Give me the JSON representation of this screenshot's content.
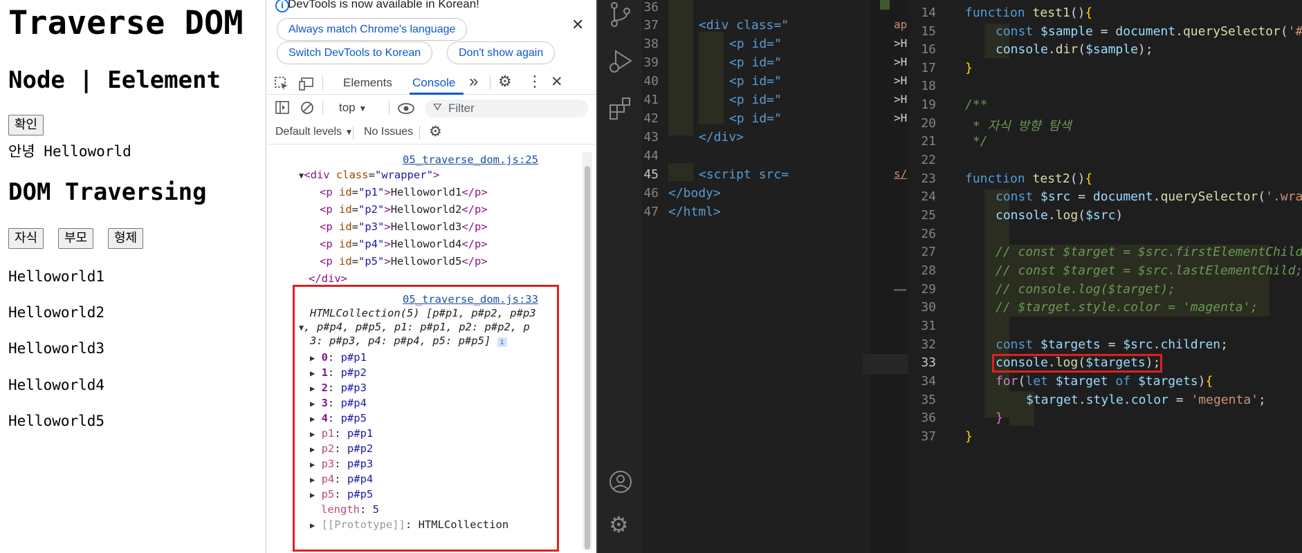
{
  "page": {
    "title": "Traverse DOM",
    "subtitle": "Node | Eelement",
    "confirm_button": "확인",
    "greeting_prefix": "안녕",
    "greeting_value": "Helloworld",
    "section_title": "DOM Traversing",
    "buttons": [
      "자식",
      "부모",
      "형제"
    ],
    "paragraphs": [
      "Helloworld1",
      "Helloworld2",
      "Helloworld3",
      "Helloworld4",
      "Helloworld5"
    ]
  },
  "devtools": {
    "infobar_text": "DevTools is now available in Korean!",
    "always_match": "Always match Chrome's language",
    "switch_korean": "Switch DevTools to Korean",
    "dont_show": "Don't show again",
    "tabs": [
      "Elements",
      "Console"
    ],
    "more_tabs": "»",
    "context": "top",
    "filter_placeholder": "Filter",
    "default_levels": "Default levels",
    "no_issues": "No Issues",
    "log1": {
      "source": "05_traverse_dom.js:25",
      "open_tag": "div",
      "class_attr": "class",
      "class_value": "\"wrapper\"",
      "paragraphs": [
        {
          "id": "\"p1\"",
          "text": "Helloworld1"
        },
        {
          "id": "\"p2\"",
          "text": "Helloworld2"
        },
        {
          "id": "\"p3\"",
          "text": "Helloworld3"
        },
        {
          "id": "\"p4\"",
          "text": "Helloworld4"
        },
        {
          "id": "\"p5\"",
          "text": "Helloworld5"
        }
      ],
      "close_tag": "</div>"
    },
    "log2": {
      "source": "05_traverse_dom.js:33",
      "summary_line1": "HTMLCollection(5) [p#p1, p#p2, p#p3",
      "summary_line2": ", p#p4, p#p5, p1: p#p1, p2: p#p2, p",
      "summary_line3": "3: p#p3, p4: p#p4, p5: p#p5]",
      "items": [
        {
          "key": "0",
          "value": "p#p1"
        },
        {
          "key": "1",
          "value": "p#p2"
        },
        {
          "key": "2",
          "value": "p#p3"
        },
        {
          "key": "3",
          "value": "p#p4"
        },
        {
          "key": "4",
          "value": "p#p5"
        },
        {
          "key": "p1",
          "value": "p#p1"
        },
        {
          "key": "p2",
          "value": "p#p2"
        },
        {
          "key": "p3",
          "value": "p#p3"
        },
        {
          "key": "p4",
          "value": "p#p4"
        },
        {
          "key": "p5",
          "value": "p#p5"
        }
      ],
      "length_key": "length",
      "length_value": "5",
      "prototype_key": "[[Prototype]]",
      "prototype_value": "HTMLCollection"
    }
  },
  "editor_left": {
    "lines": [
      {
        "n": "36",
        "html": ""
      },
      {
        "n": "37",
        "html": "<div class=\""
      },
      {
        "n": "38",
        "html": "<p id=\""
      },
      {
        "n": "39",
        "html": "<p id=\""
      },
      {
        "n": "40",
        "html": "<p id=\""
      },
      {
        "n": "41",
        "html": "<p id=\""
      },
      {
        "n": "42",
        "html": "<p id=\""
      },
      {
        "n": "43",
        "html": "</div>"
      },
      {
        "n": "44",
        "html": ""
      },
      {
        "n": "45",
        "html": "<script src="
      },
      {
        "n": "46",
        "html": "</body>"
      },
      {
        "n": "47",
        "html": "</html>"
      }
    ],
    "fragments": {
      "r37": "ap",
      "r38": ">H",
      "r39": ">H",
      "r40": ">H",
      "r41": ">H",
      "r42": ">H",
      "r45": "s/"
    }
  },
  "editor_right": {
    "lines": [
      {
        "n": "14",
        "text": "function test1(){"
      },
      {
        "n": "15",
        "text": "const $sample = document.querySelector('#sa"
      },
      {
        "n": "16",
        "text": "console.dir($sample);"
      },
      {
        "n": "17",
        "text": "}"
      },
      {
        "n": "18",
        "text": ""
      },
      {
        "n": "19",
        "text": "/**"
      },
      {
        "n": "20",
        "text": " * 자식 방향 탐색"
      },
      {
        "n": "21",
        "text": " */"
      },
      {
        "n": "22",
        "text": ""
      },
      {
        "n": "23",
        "text": "function test2(){"
      },
      {
        "n": "24",
        "text": "const $src = document.querySelector('.wrappe"
      },
      {
        "n": "25",
        "text": "console.log($src)"
      },
      {
        "n": "26",
        "text": ""
      },
      {
        "n": "27",
        "text": "// const $target = $src.firstElementChild;"
      },
      {
        "n": "28",
        "text": "// const $target = $src.lastElementChild;"
      },
      {
        "n": "29",
        "text": "// console.log($target);"
      },
      {
        "n": "30",
        "text": "// $target.style.color = 'magenta';"
      },
      {
        "n": "31",
        "text": ""
      },
      {
        "n": "32",
        "text": "const $targets = $src.children;"
      },
      {
        "n": "33",
        "text": "console.log($targets);"
      },
      {
        "n": "34",
        "text": "for(let $target of $targets){"
      },
      {
        "n": "35",
        "text": "$target.style.color = 'megenta';"
      },
      {
        "n": "36",
        "text": "}"
      },
      {
        "n": "37",
        "text": "}"
      }
    ]
  },
  "colors": {
    "highlight_box": "#e02020",
    "devtools_accent": "#0b57d0",
    "editor_bg": "#1e1e1e"
  }
}
